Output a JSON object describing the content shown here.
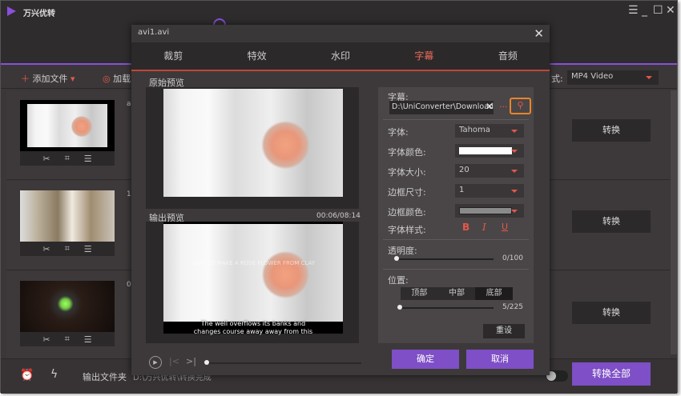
{
  "app": {
    "title": "万兴优转",
    "window_controls": [
      "menu",
      "minimize",
      "maximize",
      "close"
    ]
  },
  "toolbar": {
    "add_file": "添加文件",
    "load": "加载",
    "format_label": "式:",
    "format_value": "MP4 Video"
  },
  "items": [
    {
      "meta": "a",
      "convert": "转换"
    },
    {
      "meta": "1",
      "convert": "转换"
    },
    {
      "meta": "0",
      "convert": "转换"
    }
  ],
  "footer": {
    "output_folder_label": "输出文件夹",
    "output_path": "D:\\万兴优转\\转换完成",
    "convert_all": "转换全部"
  },
  "dialog": {
    "title": "avi1.avi",
    "tabs": [
      {
        "label": "裁剪"
      },
      {
        "label": "特效"
      },
      {
        "label": "水印"
      },
      {
        "label": "字幕",
        "active": true
      },
      {
        "label": "音频"
      }
    ],
    "original_preview": "原始预览",
    "output_preview": "输出预览",
    "time": "00:06/08:14",
    "watermark_text": "HOW TO MAKE A ROSE FLOWER FROM CLAY",
    "subtitle_line1": "The well overflows its banks and",
    "subtitle_line2": "changes course away away from this",
    "progress": 0.0,
    "subtitle": {
      "label": "字幕:",
      "path": "D:\\UniConverter\\Downloade",
      "more": "···",
      "font_label": "字体:",
      "font": "Tahoma",
      "font_color_label": "字体颜色:",
      "font_color": "#ffffff",
      "font_size_label": "字体大小:",
      "font_size": "20",
      "border_size_label": "边框尺寸:",
      "border_size": "1",
      "border_color_label": "边框颜色:",
      "border_color": "#8a8a8a",
      "font_style_label": "字体样式:",
      "bold": "B",
      "italic": "I",
      "underline": "U",
      "opacity_label": "透明度:",
      "opacity_value": "0/100",
      "opacity": 0,
      "position_label": "位置:",
      "positions": [
        "顶部",
        "中部",
        "底部"
      ],
      "position_selected": "底部",
      "position_value": "5/225",
      "position": 5,
      "reset": "重设"
    },
    "ok": "确定",
    "cancel": "取消"
  }
}
